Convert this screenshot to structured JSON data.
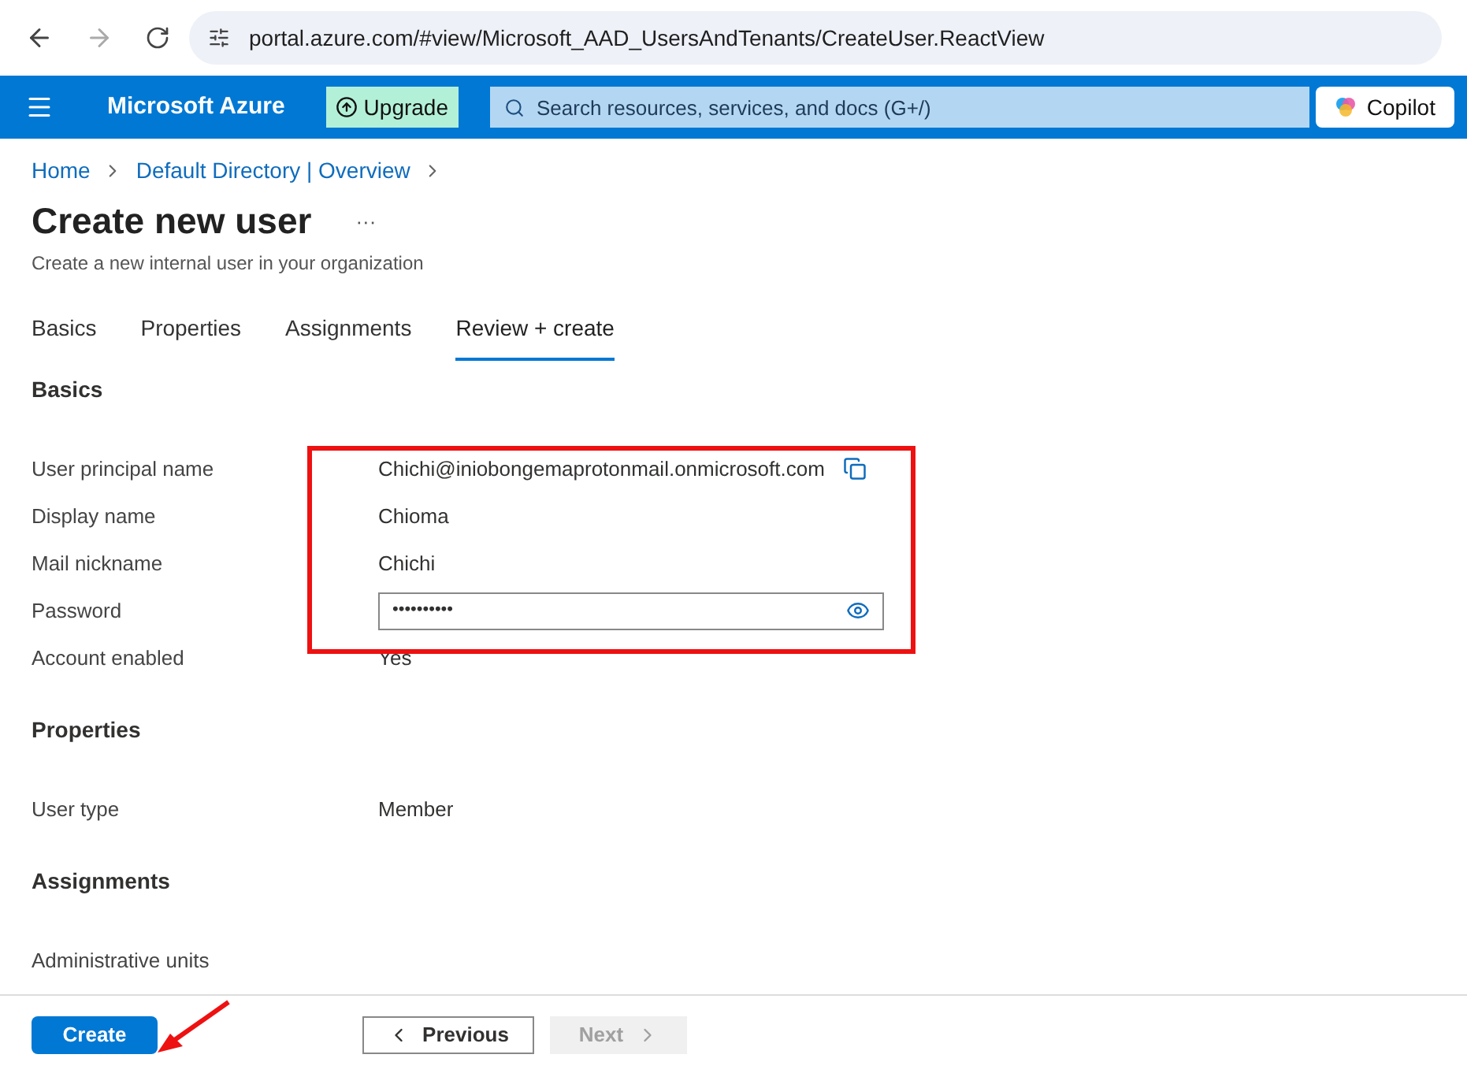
{
  "browser": {
    "url": "portal.azure.com/#view/Microsoft_AAD_UsersAndTenants/CreateUser.ReactView"
  },
  "header": {
    "brand": "Microsoft Azure",
    "upgrade": "Upgrade",
    "search_placeholder": "Search resources, services, and docs (G+/)",
    "copilot": "Copilot"
  },
  "breadcrumb": [
    "Home",
    "Default Directory | Overview"
  ],
  "page": {
    "title": "Create new user",
    "more": "···",
    "subtitle": "Create a new internal user in your organization"
  },
  "tabs": [
    {
      "label": "Basics",
      "selected": false
    },
    {
      "label": "Properties",
      "selected": false
    },
    {
      "label": "Assignments",
      "selected": false
    },
    {
      "label": "Review + create",
      "selected": true
    }
  ],
  "sections": [
    {
      "title": "Basics",
      "highlighted": true,
      "rows": [
        {
          "kind": "copy",
          "label": "User principal name",
          "value": "Chichi@iniobongemaprotonmail.onmicrosoft.com"
        },
        {
          "kind": "text",
          "label": "Display name",
          "value": "Chioma"
        },
        {
          "kind": "text",
          "label": "Mail nickname",
          "value": "Chichi"
        },
        {
          "kind": "password",
          "label": "Password",
          "value": "••••••••••"
        },
        {
          "kind": "text",
          "label": "Account enabled",
          "value": "Yes"
        }
      ]
    },
    {
      "title": "Properties",
      "highlighted": false,
      "rows": [
        {
          "kind": "text",
          "label": "User type",
          "value": "Member"
        }
      ]
    },
    {
      "title": "Assignments",
      "highlighted": false,
      "rows": [
        {
          "kind": "text",
          "label": "Administrative units",
          "value": ""
        }
      ]
    }
  ],
  "footer": {
    "create": "Create",
    "previous": "Previous",
    "next": "Next",
    "next_disabled": true
  }
}
